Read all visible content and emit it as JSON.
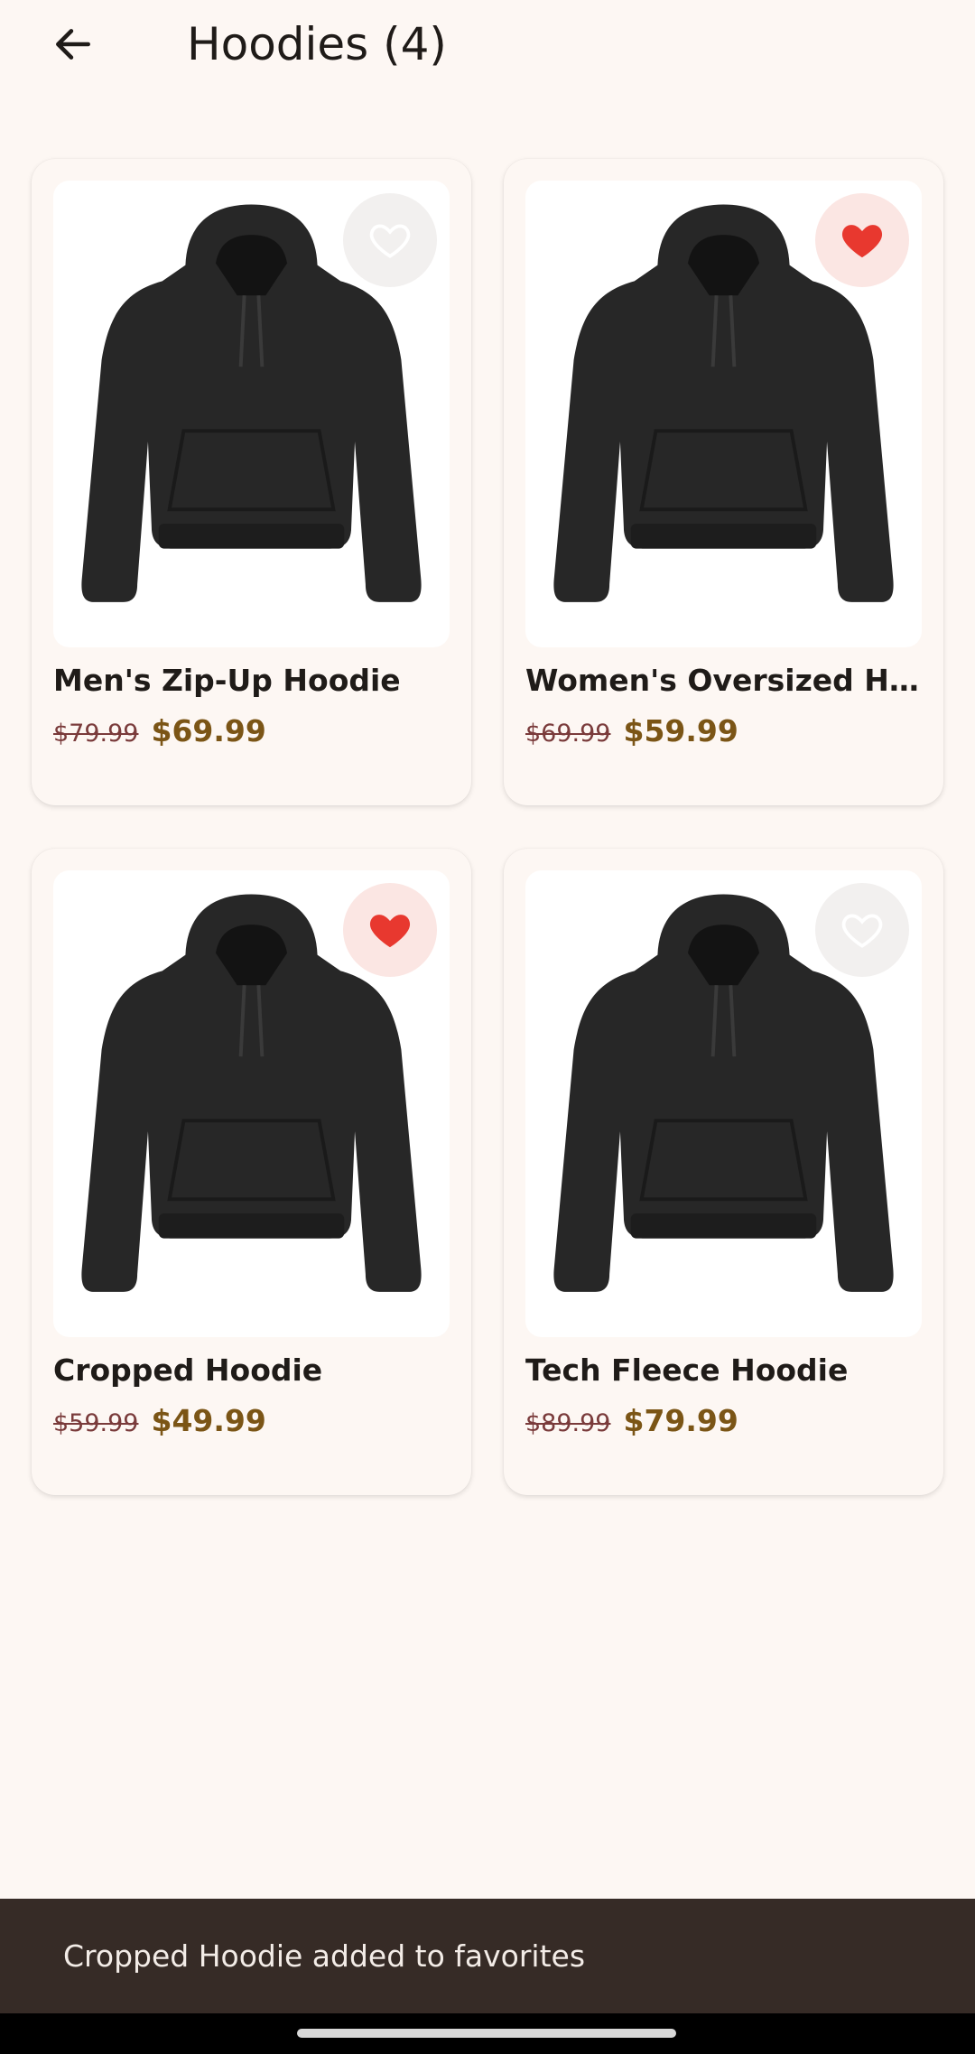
{
  "header": {
    "title": "Hoodies (4)",
    "back_icon": "arrow-left-icon"
  },
  "products": [
    {
      "name": "Men's Zip-Up Hoodie",
      "old_price": "$79.99",
      "price": "$69.99",
      "favorite": false
    },
    {
      "name": "Women's Oversized Hoo...",
      "old_price": "$69.99",
      "price": "$59.99",
      "favorite": true
    },
    {
      "name": "Cropped Hoodie",
      "old_price": "$59.99",
      "price": "$49.99",
      "favorite": true
    },
    {
      "name": "Tech Fleece Hoodie",
      "old_price": "$89.99",
      "price": "$79.99",
      "favorite": false
    }
  ],
  "snackbar": {
    "message": "Cropped Hoodie added to favorites"
  },
  "colors": {
    "background": "#fdf7f3",
    "favorite_active": "#e8382f",
    "price": "#7b5516",
    "old_price": "#7a3b3b",
    "snackbar": "#362b26"
  }
}
